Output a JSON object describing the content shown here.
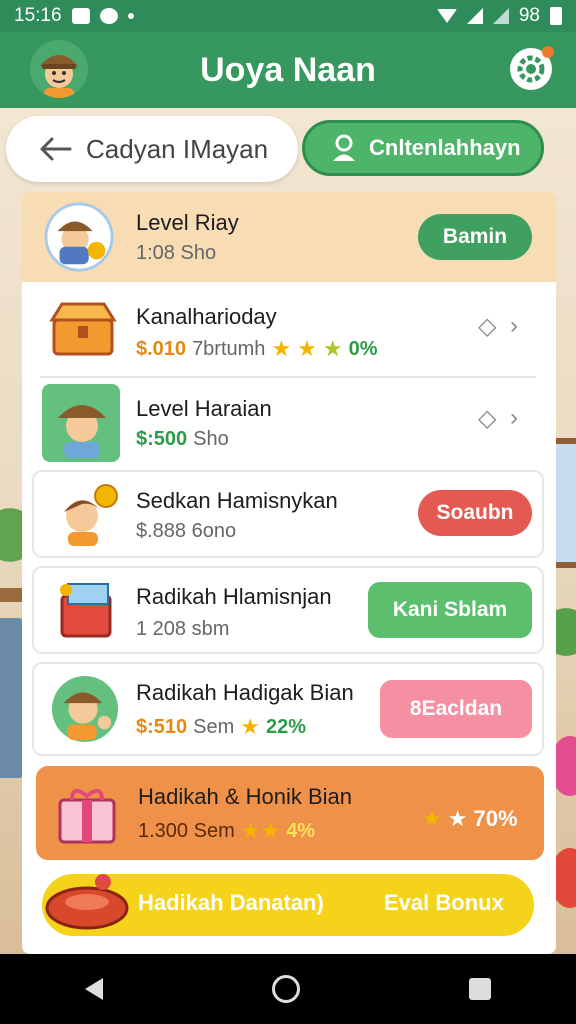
{
  "status_bar": {
    "time": "15:16",
    "battery": "98"
  },
  "app_bar": {
    "title": "Uoya Naan"
  },
  "top_nav": {
    "back_label": "Cadyan IMayan",
    "profile_tab_label": "Cnltenlahhayn"
  },
  "rows": [
    {
      "title": "Level Riay",
      "subtitle": "1:08 Sho",
      "button": "Bamin"
    },
    {
      "title": "Kanalharioday",
      "money": "$.010",
      "subtitle": "7brtumh",
      "percent": "0%"
    },
    {
      "title": "Level Haraian",
      "money": "$:500",
      "subtitle": "Sho"
    },
    {
      "title": "Sedkan Hamisnykan",
      "subtitle": "$.888 6ono",
      "button": "Soaubn"
    },
    {
      "title": "Radikah Hlamisnjan",
      "subtitle": "1 208 sbm",
      "button": "Kani Sblam"
    },
    {
      "title": "Radikah Hadigak Bian",
      "money": "$:510",
      "subtitle": "Sem",
      "percent": "22%",
      "button": "8Eacldan"
    },
    {
      "title": "Hadikah & Honik Bian",
      "subtitle": "1.300 Sem",
      "percent": "4%",
      "right_percent": "70%"
    },
    {
      "title": "Hadikah Danatan)",
      "button": "Eval Bonux"
    }
  ],
  "colors": {
    "primary_green": "#36985f",
    "orange": "#f0914a",
    "yellow": "#f5d31a",
    "red": "#e45a52",
    "pink": "#f58fa2"
  }
}
